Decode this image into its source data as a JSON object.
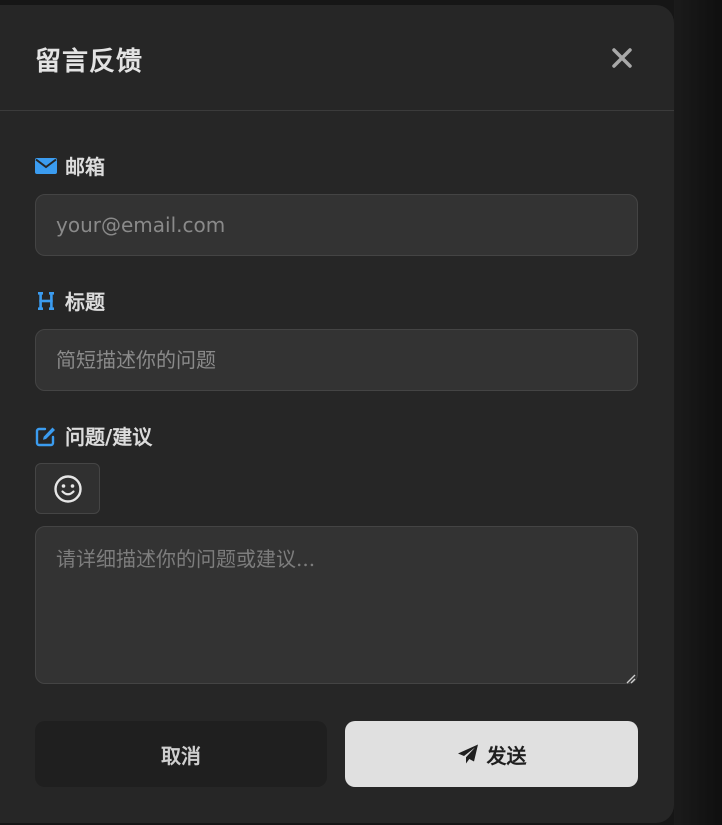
{
  "modal": {
    "title": "留言反馈",
    "close_icon": "close-icon"
  },
  "fields": {
    "email": {
      "label": "邮箱",
      "icon": "envelope-icon",
      "placeholder": "your@email.com",
      "value": ""
    },
    "subject": {
      "label": "标题",
      "icon": "heading-icon",
      "placeholder": "简短描述你的问题",
      "value": ""
    },
    "message": {
      "label": "问题/建议",
      "icon": "edit-icon",
      "emoji_icon": "smile-icon",
      "placeholder": "请详细描述你的问题或建议...",
      "value": ""
    }
  },
  "actions": {
    "cancel_label": "取消",
    "send_label": "发送",
    "send_icon": "paper-plane-icon"
  },
  "colors": {
    "accent": "#3b9cf0",
    "modal_bg": "#262626",
    "input_bg": "#333333",
    "send_bg": "#e0e0e0",
    "cancel_bg": "#1f1f1f"
  }
}
